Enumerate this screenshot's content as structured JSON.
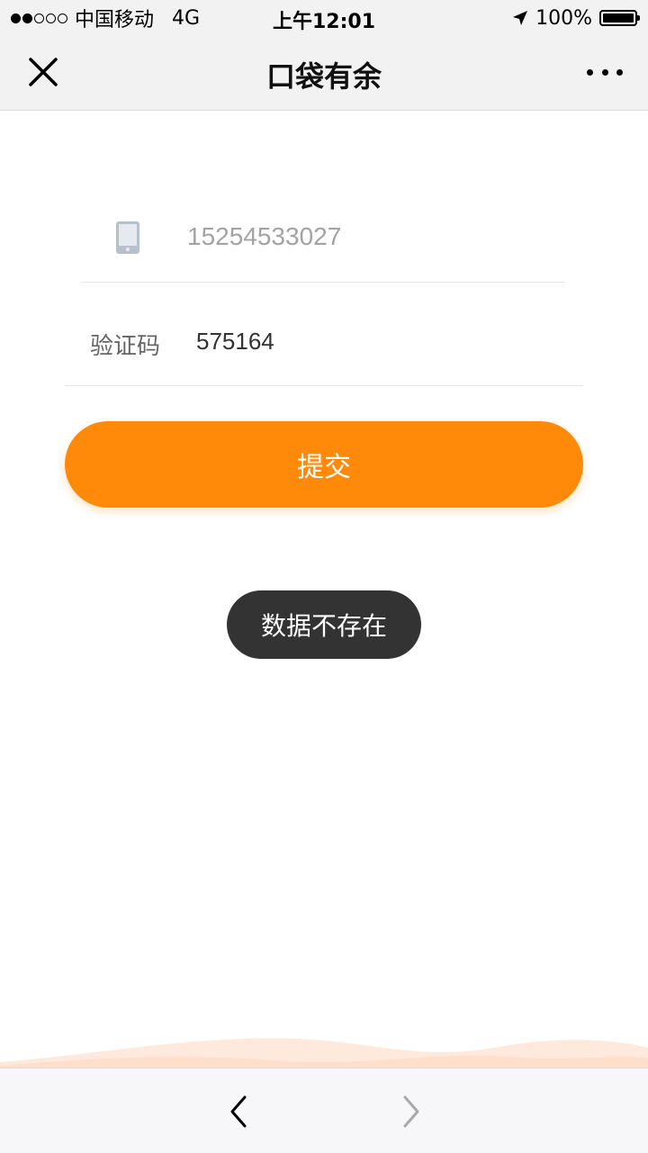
{
  "status_bar": {
    "carrier": "中国移动",
    "network": "4G",
    "time": "上午12:01",
    "battery_percent": "100%",
    "signal_strength": 2,
    "icons": [
      "signal-icon",
      "location-arrow-icon",
      "battery-icon"
    ]
  },
  "nav_bar": {
    "title": "口袋有余",
    "close_icon": "close-icon",
    "more_icon": "more-icon"
  },
  "form": {
    "phone": {
      "icon": "phone-icon",
      "value": "15254533027"
    },
    "code": {
      "label": "验证码",
      "value": "575164"
    },
    "submit_label": "提交"
  },
  "toast": {
    "message": "数据不存在"
  },
  "bottom_bar": {
    "back_icon": "chevron-left-icon",
    "forward_icon": "chevron-right-icon"
  },
  "colors": {
    "accent": "#ff8a0a",
    "toast_bg": "#333333",
    "bar_bg": "#f2f2f2"
  }
}
